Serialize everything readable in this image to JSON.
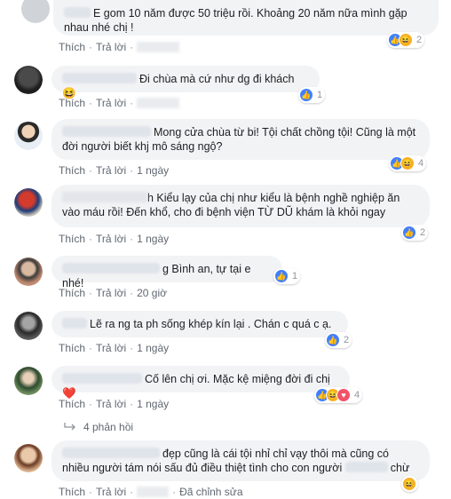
{
  "labels": {
    "like": "Thích",
    "reply": "Trả lời",
    "edited": "Đã chỉnh sửa",
    "dot": "·"
  },
  "colors": {
    "bubble": "#f2f3f5",
    "like_blue": "#4080ff",
    "haha_yellow": "#f7b125",
    "love_red": "#f25268"
  },
  "comments": [
    {
      "text": "E gom 10 năm được 50 triệu rồi. Khoảng 20 năm nữa mình gặp nhau nhé chị !",
      "reactions": [
        "like-icon",
        "haha-icon"
      ],
      "count": "2",
      "time": ""
    },
    {
      "text": "Đi chùa mà cứ như dg đi khách 😆",
      "reactions": [
        "like-icon"
      ],
      "count": "1",
      "time": ""
    },
    {
      "text": "Mong cửa chùa từ bi! Tội chất chồng tội! Cũng là một đời người biết khj mô sáng ngộ?",
      "reactions": [
        "like-icon",
        "haha-icon"
      ],
      "count": "4",
      "time": "1 ngày"
    },
    {
      "text": "h Kiểu lạy của chị như kiểu là bệnh nghề nghiệp ăn vào máu rồi! Đến khổ, cho đi bệnh viện TỪ DŨ khám là khỏi ngay",
      "reactions": [
        "like-icon"
      ],
      "count": "2",
      "time": "1 ngày"
    },
    {
      "text": "g Bình an, tự tại e nhé!",
      "reactions": [
        "like-icon"
      ],
      "count": "1",
      "time": "20 giờ"
    },
    {
      "text": "Lẽ ra ng ta ph sống khép kín lại . Chán c quá c ạ.",
      "reactions": [
        "like-icon"
      ],
      "count": "2",
      "time": "1 ngày"
    },
    {
      "text": "Cố lên chị ơi. Mặc kệ miệng đời đi chị ❤️",
      "reactions": [
        "like-icon",
        "haha-icon",
        "love-icon"
      ],
      "count": "4",
      "time": "1 ngày"
    },
    {
      "text": "đẹp cũng là cái tội nhỉ chỉ vạy thôi mà cũng có nhiều người tám nói sấu đủ điều thiệt tình cho con người",
      "text_end": "chừ",
      "reactions": [
        "haha-icon"
      ],
      "count": "",
      "time": ""
    }
  ],
  "replies_link": "4 phản hồi"
}
